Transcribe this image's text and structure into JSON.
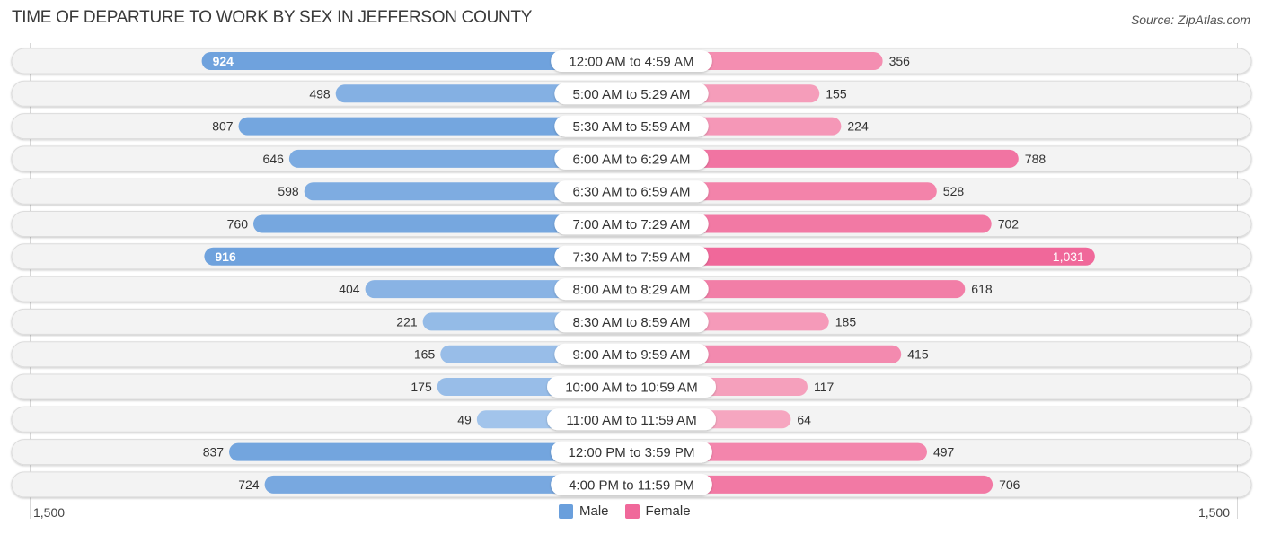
{
  "title": "TIME OF DEPARTURE TO WORK BY SEX IN JEFFERSON COUNTY",
  "source": "Source: ZipAtlas.com",
  "colors": {
    "male_strong": "#6a9fdc",
    "male_light": "#aac9ed",
    "female_strong": "#f0689a",
    "female_light": "#f7b0c6",
    "track": "#f3f3f3"
  },
  "chart_data": {
    "type": "bar",
    "orientation": "horizontal-diverging",
    "title": "TIME OF DEPARTURE TO WORK BY SEX IN JEFFERSON COUNTY",
    "categories": [
      "12:00 AM to 4:59 AM",
      "5:00 AM to 5:29 AM",
      "5:30 AM to 5:59 AM",
      "6:00 AM to 6:29 AM",
      "6:30 AM to 6:59 AM",
      "7:00 AM to 7:29 AM",
      "7:30 AM to 7:59 AM",
      "8:00 AM to 8:29 AM",
      "8:30 AM to 8:59 AM",
      "9:00 AM to 9:59 AM",
      "10:00 AM to 10:59 AM",
      "11:00 AM to 11:59 AM",
      "12:00 PM to 3:59 PM",
      "4:00 PM to 11:59 PM"
    ],
    "series": [
      {
        "name": "Male",
        "side": "left",
        "values": [
          924,
          498,
          807,
          646,
          598,
          760,
          916,
          404,
          221,
          165,
          175,
          49,
          837,
          724
        ],
        "labels": [
          "924",
          "498",
          "807",
          "646",
          "598",
          "760",
          "916",
          "404",
          "221",
          "165",
          "175",
          "49",
          "837",
          "724"
        ]
      },
      {
        "name": "Female",
        "side": "right",
        "values": [
          356,
          155,
          224,
          788,
          528,
          702,
          1031,
          618,
          185,
          415,
          117,
          64,
          497,
          706
        ],
        "labels": [
          "356",
          "155",
          "224",
          "788",
          "528",
          "702",
          "1,031",
          "618",
          "185",
          "415",
          "117",
          "64",
          "497",
          "706"
        ]
      }
    ],
    "axis": {
      "left_label": "1,500",
      "right_label": "1,500",
      "range": [
        0,
        1500
      ]
    },
    "legend": {
      "position": "bottom-center",
      "entries": [
        "Male",
        "Female"
      ]
    },
    "grid": false
  }
}
